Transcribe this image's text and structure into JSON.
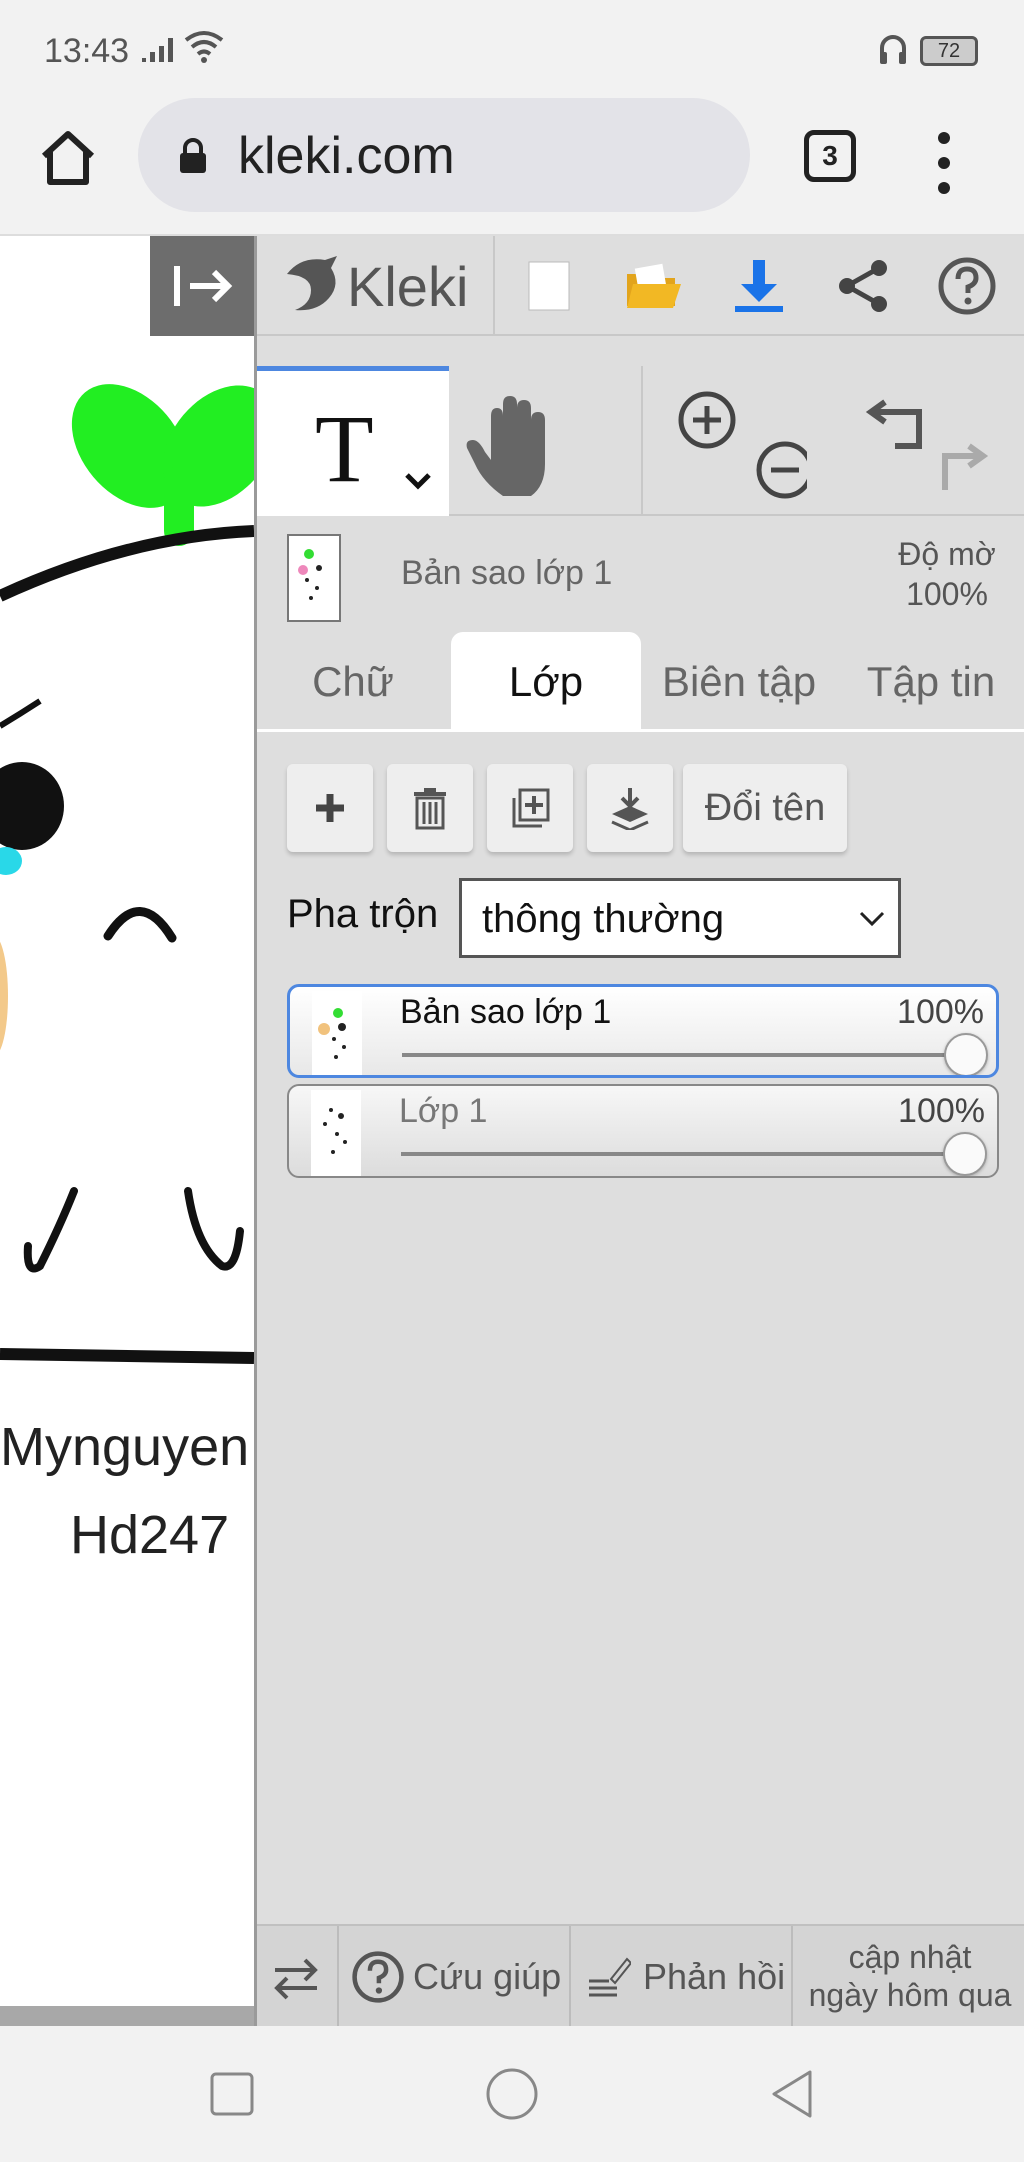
{
  "status_bar": {
    "time": "13:43",
    "battery": "72"
  },
  "browser": {
    "url": "kleki.com",
    "tab_count": "3"
  },
  "canvas": {
    "text_line1": "Mynguyen",
    "text_line2": "Hd247"
  },
  "kleki": {
    "logo": "Kleki",
    "layer_info": {
      "name": "Bản sao lớp 1",
      "opacity_label": "Độ mờ",
      "opacity_value": "100%"
    },
    "tabs": [
      {
        "label": "Chữ",
        "active": false
      },
      {
        "label": "Lớp",
        "active": true
      },
      {
        "label": "Biên tập",
        "active": false
      },
      {
        "label": "Tập tin",
        "active": false
      }
    ],
    "actions": {
      "rename": "Đổi tên"
    },
    "blend": {
      "label": "Pha trộn",
      "value": "thông thường"
    },
    "layers": [
      {
        "name": "Bản sao lớp 1",
        "opacity": "100%",
        "opacity_fraction": 1.0,
        "selected": true
      },
      {
        "name": "Lớp 1",
        "opacity": "100%",
        "opacity_fraction": 1.0,
        "selected": false
      }
    ],
    "footer": {
      "help": "Cứu giúp",
      "feedback": "Phản hồi",
      "update_line1": "cập nhật",
      "update_line2": "ngày hôm qua"
    }
  },
  "colors": {
    "accent": "#4d87e0",
    "download": "#1a73e8",
    "folder": "#f2b824",
    "sprout": "#22ee22"
  }
}
